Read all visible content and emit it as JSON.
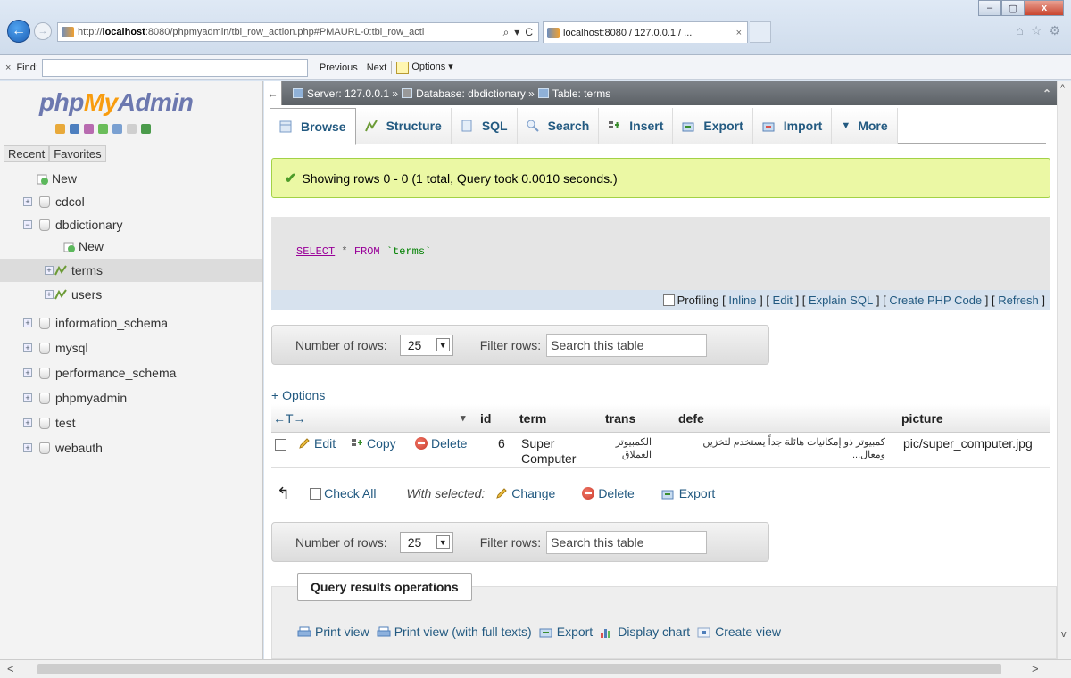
{
  "browser": {
    "url_prefix": "http://",
    "url_host": "localhost",
    "url_rest": ":8080/phpmyadmin/tbl_row_action.php#PMAURL-0:tbl_row_acti",
    "tab_title": "localhost:8080 / 127.0.0.1 / ...",
    "tab_close": "×",
    "url_controls": [
      "⌕",
      "▾",
      "C"
    ],
    "toolbar_icons": [
      "⌂",
      "☆",
      "⚙"
    ],
    "window_buttons": [
      "‒",
      "▢",
      "x"
    ],
    "find": {
      "close": "×",
      "label": "Find:",
      "value": "",
      "previous": "Previous",
      "next": "Next",
      "options": "Options ▾"
    }
  },
  "sidebar": {
    "logo_php": "php",
    "logo_my": "My",
    "logo_admin": "Admin",
    "recent": "Recent",
    "favorites": "Favorites",
    "tree": [
      {
        "label": "New"
      },
      {
        "label": "cdcol"
      },
      {
        "label": "dbdictionary"
      },
      {
        "label": "New"
      },
      {
        "label": "terms"
      },
      {
        "label": "users"
      },
      {
        "label": "information_schema"
      },
      {
        "label": "mysql"
      },
      {
        "label": "performance_schema"
      },
      {
        "label": "phpmyadmin"
      },
      {
        "label": "test"
      },
      {
        "label": "webauth"
      }
    ]
  },
  "breadcrumb": {
    "collapse": "←",
    "server": "Server: 127.0.0.1 »",
    "database": "Database: dbdictionary »",
    "table": "Table: terms",
    "up": "⌃"
  },
  "tabs": [
    {
      "label": "Browse"
    },
    {
      "label": "Structure"
    },
    {
      "label": "SQL"
    },
    {
      "label": "Search"
    },
    {
      "label": "Insert"
    },
    {
      "label": "Export"
    },
    {
      "label": "Import"
    },
    {
      "label": "More"
    }
  ],
  "success_message": "Showing rows 0 - 0 (1 total, Query took 0.0010 seconds.)",
  "sql": {
    "select": "SELECT",
    "star": " * ",
    "from": "FROM",
    "table": " `terms`"
  },
  "profiling": {
    "label": "Profiling",
    "inline": "Inline",
    "edit": "Edit",
    "explain": "Explain SQL",
    "create_php": "Create PHP Code",
    "refresh": "Refresh"
  },
  "nav_top": {
    "rows_label": "Number of rows:",
    "rows_value": "25",
    "filter_label": "Filter rows:",
    "filter_placeholder": "Search this table"
  },
  "nav_bottom": {
    "rows_label": "Number of rows:",
    "rows_value": "25",
    "filter_label": "Filter rows:",
    "filter_placeholder": "Search this table"
  },
  "options_link": "+ Options",
  "results": {
    "arrows": "←T→",
    "sort_indicator": "▾",
    "headers": [
      "id",
      "term",
      "trans",
      "defe",
      "picture"
    ],
    "rows": [
      {
        "edit": "Edit",
        "copy": "Copy",
        "delete": "Delete",
        "id": "6",
        "term_line1": "Super",
        "term_line2": "Computer",
        "trans_line1": "الكمبيوتر",
        "trans_line2": "العملاق",
        "defe_line1": "كمبيوتر ذو إمكانيات هائلة جداً يستخدم لتخزين",
        "defe_line2": "ومعال...",
        "picture": "pic/super_computer.jpg"
      }
    ]
  },
  "with_selected": {
    "check_all": "Check All",
    "label": "With selected:",
    "change": "Change",
    "delete": "Delete",
    "export": "Export"
  },
  "query_ops": {
    "legend": "Query results operations",
    "print_view": "Print view",
    "print_full": "Print view (with full texts)",
    "export": "Export",
    "display_chart": "Display chart",
    "create_view": "Create view"
  },
  "scroll": {
    "left": "<",
    "right": ">",
    "up": "^",
    "down": "v"
  }
}
